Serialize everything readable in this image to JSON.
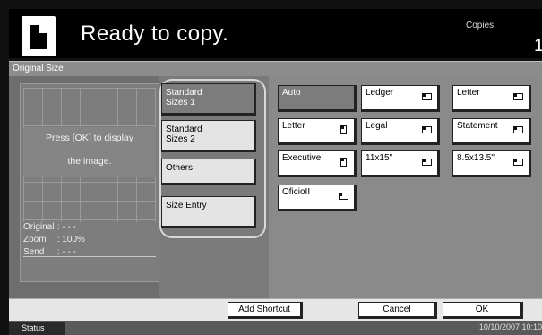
{
  "header": {
    "title": "Ready to copy.",
    "copies_label": "Copies",
    "copies_value": "1"
  },
  "section": {
    "title": "Original Size"
  },
  "preview": {
    "message_line1": "Press [OK] to display",
    "message_line2": "the image.",
    "original_label": "Original",
    "original_value": ": - - -",
    "zoom_label": "Zoom",
    "zoom_value": ": 100%",
    "send_label": "Send",
    "send_value": ": - - -"
  },
  "tabs": [
    {
      "line1": "Standard",
      "line2": "Sizes 1",
      "selected": true
    },
    {
      "line1": "Standard",
      "line2": "Sizes 2",
      "selected": false
    },
    {
      "line1": "Others",
      "line2": "",
      "selected": false
    },
    {
      "line1": "Size Entry",
      "line2": "",
      "selected": false
    }
  ],
  "sizes": [
    {
      "label": "Auto",
      "icon": "",
      "selected": true
    },
    {
      "label": "Ledger",
      "icon": "landscape-page-icon"
    },
    {
      "label": "Letter",
      "icon": "landscape-page-icon"
    },
    {
      "label": "Letter",
      "icon": "portrait-page-icon"
    },
    {
      "label": "Legal",
      "icon": "landscape-page-icon"
    },
    {
      "label": "Statement",
      "icon": "landscape-page-icon"
    },
    {
      "label": "Executive",
      "icon": "portrait-page-icon"
    },
    {
      "label": "11x15\"",
      "icon": "landscape-page-icon"
    },
    {
      "label": "8.5x13.5\"",
      "icon": "landscape-page-icon"
    },
    {
      "label": "OficioII",
      "icon": "landscape-page-icon"
    }
  ],
  "bottom": {
    "add_shortcut": "Add Shortcut",
    "cancel": "Cancel",
    "ok": "OK"
  },
  "status": {
    "label": "Status",
    "datetime": "10/10/2007  10:10"
  }
}
